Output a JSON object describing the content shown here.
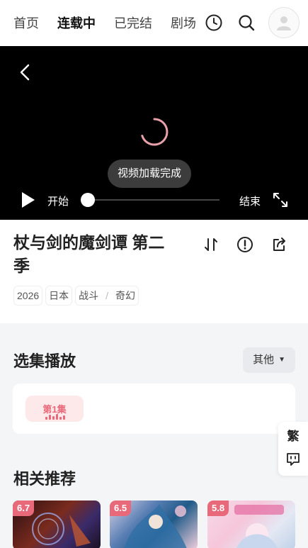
{
  "nav": {
    "tabs": [
      {
        "label": "首页"
      },
      {
        "label": "连载中"
      },
      {
        "label": "已完结"
      },
      {
        "label": "剧场"
      }
    ],
    "active_tab": "连载中",
    "icons": [
      "history-icon",
      "search-icon",
      "avatar"
    ]
  },
  "player": {
    "toast": "视频加载完成",
    "time_start": "开始",
    "time_end": "结束",
    "progress": 0,
    "spinner_color": "#e8a0aa"
  },
  "info": {
    "title": "杖与剑的魔剑谭 第二季",
    "tags": [
      "2026",
      "日本",
      "战斗",
      "奇幻"
    ],
    "actions": [
      "sort-icon",
      "report-icon",
      "share-icon"
    ]
  },
  "episodes": {
    "title": "选集播放",
    "other_label": "其他",
    "items": [
      {
        "label": "第1集",
        "active": true
      }
    ]
  },
  "side": {
    "trad_label": "繁",
    "feedback_icon": "feedback-icon"
  },
  "recs": {
    "title": "相关推荐",
    "items": [
      {
        "score": "6.7"
      },
      {
        "score": "6.5"
      },
      {
        "score": "5.8"
      }
    ]
  },
  "colors": {
    "accent": "#e8697a",
    "tab_underline": "#f7c948",
    "player_bg": "#000000"
  }
}
